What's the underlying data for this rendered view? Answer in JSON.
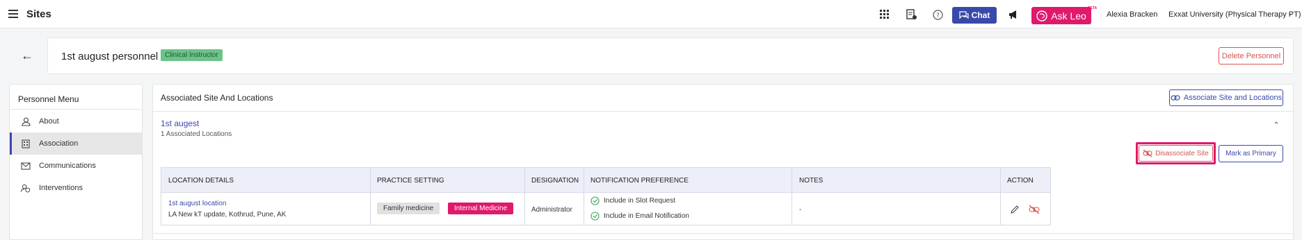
{
  "topbar": {
    "title": "Sites",
    "chat_label": "Chat",
    "askleo_label": "Ask Leo",
    "beta_label": "BETA",
    "user_name": "Alexia Bracken",
    "organization": "Exxat University (Physical Therapy PT)",
    "icons": [
      "grid-icon",
      "report-icon",
      "help-icon",
      "megaphone-icon"
    ]
  },
  "header": {
    "person_name": "1st august personnel",
    "role_badge": "Clinical Instructor",
    "delete_label": "Delete Personnel"
  },
  "menu": {
    "title": "Personnel Menu",
    "items": [
      {
        "label": "About",
        "icon": "person-icon",
        "active": false
      },
      {
        "label": "Association",
        "icon": "building-icon",
        "active": true
      },
      {
        "label": "Communications",
        "icon": "mail-icon",
        "active": false
      },
      {
        "label": "Interventions",
        "icon": "person-shield-icon",
        "active": false
      }
    ]
  },
  "main": {
    "section_title": "Associated Site And Locations",
    "associate_label": "Associate Site and Locations",
    "site": {
      "name": "1st augest",
      "locations_count": "1 Associated Locations",
      "disassociate_label": "Disassociate Site",
      "primary_label": "Mark as Primary"
    },
    "table": {
      "headers": [
        "LOCATION DETAILS",
        "PRACTICE SETTING",
        "DESIGNATION",
        "NOTIFICATION PREFERENCE",
        "NOTES",
        "ACTION"
      ],
      "rows": [
        {
          "location_name": "1st august location",
          "location_address": "LA New kT update, Kothrud, Pune, AK",
          "practice_settings": [
            "Family medicine",
            "Internal Medicine"
          ],
          "designation": "Administrator",
          "notifications": [
            "Include in Slot Request",
            "Include in Email Notification"
          ],
          "notes": "-"
        }
      ]
    }
  },
  "colors": {
    "accent": "#3949ab",
    "pink": "#e0196b",
    "danger": "#d9534f",
    "badge_green": "#6cc28a"
  }
}
